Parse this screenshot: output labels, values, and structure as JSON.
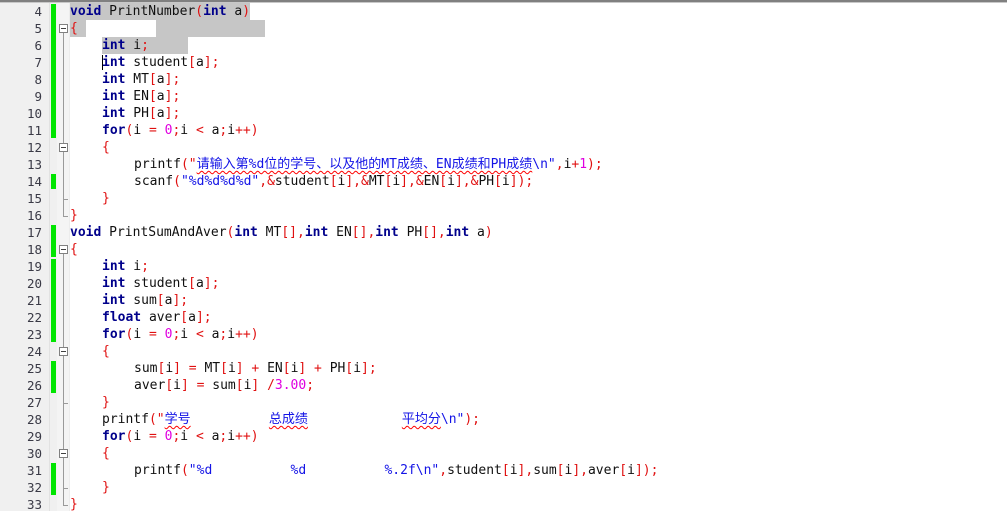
{
  "editor": {
    "first_line": 4,
    "last_line": 33,
    "line_height": 17,
    "colors": {
      "background": "#ffffff",
      "gutter_background": "#f0f0f0",
      "line_number": "#3a3a46",
      "keyword": "#00008b",
      "identifier": "#101010",
      "punctuation": "#e01010",
      "string": "#1414e6",
      "number": "#e000e0",
      "change_bar": "#00e500",
      "selection": "#c6c6c6",
      "fold_line": "#9a9a9a",
      "spellcheck_underline": "#ff0000"
    }
  },
  "lines": [
    {
      "n": "4",
      "indent": 0,
      "text": "void PrintNumber(int a)",
      "tokens": [
        [
          "kw",
          "void"
        ],
        [
          "id",
          " PrintNumber"
        ],
        [
          "pun",
          "("
        ],
        [
          "kw",
          "int"
        ],
        [
          "id",
          " a"
        ],
        [
          "pun",
          ")"
        ]
      ]
    },
    {
      "n": "5",
      "indent": 0,
      "text": "{",
      "tokens": [
        [
          "brc",
          "{"
        ]
      ]
    },
    {
      "n": "6",
      "indent": 1,
      "text": "int i;",
      "tokens": [
        [
          "kw",
          "int"
        ],
        [
          "id",
          " i"
        ],
        [
          "pun",
          ";"
        ]
      ]
    },
    {
      "n": "7",
      "indent": 1,
      "text": "int student[a];",
      "tokens": [
        [
          "kw",
          "int"
        ],
        [
          "id",
          " student"
        ],
        [
          "pun",
          "["
        ],
        [
          "id",
          "a"
        ],
        [
          "pun",
          "];"
        ]
      ]
    },
    {
      "n": "8",
      "indent": 1,
      "text": "int MT[a];",
      "tokens": [
        [
          "kw",
          "int"
        ],
        [
          "id",
          " MT"
        ],
        [
          "pun",
          "["
        ],
        [
          "id",
          "a"
        ],
        [
          "pun",
          "];"
        ]
      ]
    },
    {
      "n": "9",
      "indent": 1,
      "text": "int EN[a];",
      "tokens": [
        [
          "kw",
          "int"
        ],
        [
          "id",
          " EN"
        ],
        [
          "pun",
          "["
        ],
        [
          "id",
          "a"
        ],
        [
          "pun",
          "];"
        ]
      ]
    },
    {
      "n": "10",
      "indent": 1,
      "text": "int PH[a];",
      "tokens": [
        [
          "kw",
          "int"
        ],
        [
          "id",
          " PH"
        ],
        [
          "pun",
          "["
        ],
        [
          "id",
          "a"
        ],
        [
          "pun",
          "];"
        ]
      ]
    },
    {
      "n": "11",
      "indent": 1,
      "text": "for(i = 0;i < a;i++)",
      "tokens": [
        [
          "kw",
          "for"
        ],
        [
          "pun",
          "("
        ],
        [
          "id",
          "i "
        ],
        [
          "op",
          "="
        ],
        [
          "id",
          " "
        ],
        [
          "num",
          "0"
        ],
        [
          "pun",
          ";"
        ],
        [
          "id",
          "i "
        ],
        [
          "op",
          "<"
        ],
        [
          "id",
          " a"
        ],
        [
          "pun",
          ";"
        ],
        [
          "id",
          "i"
        ],
        [
          "op",
          "++"
        ],
        [
          "pun",
          ")"
        ]
      ]
    },
    {
      "n": "12",
      "indent": 1,
      "text": "{",
      "tokens": [
        [
          "brc",
          "{"
        ]
      ]
    },
    {
      "n": "13",
      "indent": 2,
      "text": "printf(\"请输入第%d位的学号、以及他的MT成绩、EN成绩和PH成绩\\n\",i+1);",
      "tokens": [
        [
          "id",
          "printf"
        ],
        [
          "pun",
          "(\""
        ],
        [
          "sq",
          "请输入第%d位的学号、以及他的MT成绩、EN成绩和PH成绩"
        ],
        [
          "str",
          "\\n\""
        ],
        [
          "pun",
          ","
        ],
        [
          "id",
          "i"
        ],
        [
          "op",
          "+"
        ],
        [
          "num",
          "1"
        ],
        [
          "pun",
          ");"
        ]
      ]
    },
    {
      "n": "14",
      "indent": 2,
      "text": "scanf(\"%d%d%d%d\",&student[i],&MT[i],&EN[i],&PH[i]);",
      "tokens": [
        [
          "id",
          "scanf"
        ],
        [
          "pun",
          "("
        ],
        [
          "str",
          "\"%d%d%d%d\""
        ],
        [
          "pun",
          ","
        ],
        [
          "op",
          "&"
        ],
        [
          "id",
          "student"
        ],
        [
          "pun",
          "["
        ],
        [
          "id",
          "i"
        ],
        [
          "pun",
          "],"
        ],
        [
          "op",
          "&"
        ],
        [
          "id",
          "MT"
        ],
        [
          "pun",
          "["
        ],
        [
          "id",
          "i"
        ],
        [
          "pun",
          "],"
        ],
        [
          "op",
          "&"
        ],
        [
          "id",
          "EN"
        ],
        [
          "pun",
          "["
        ],
        [
          "id",
          "i"
        ],
        [
          "pun",
          "],"
        ],
        [
          "op",
          "&"
        ],
        [
          "id",
          "PH"
        ],
        [
          "pun",
          "["
        ],
        [
          "id",
          "i"
        ],
        [
          "pun",
          "]);"
        ]
      ]
    },
    {
      "n": "15",
      "indent": 1,
      "text": "}",
      "tokens": [
        [
          "brc",
          "}"
        ]
      ]
    },
    {
      "n": "16",
      "indent": 0,
      "text": "}",
      "tokens": [
        [
          "brc",
          "}"
        ]
      ]
    },
    {
      "n": "17",
      "indent": 0,
      "text": "void PrintSumAndAver(int MT[],int EN[],int PH[],int a)",
      "tokens": [
        [
          "kw",
          "void"
        ],
        [
          "id",
          " PrintSumAndAver"
        ],
        [
          "pun",
          "("
        ],
        [
          "kw",
          "int"
        ],
        [
          "id",
          " MT"
        ],
        [
          "pun",
          "[],"
        ],
        [
          "kw",
          "int"
        ],
        [
          "id",
          " EN"
        ],
        [
          "pun",
          "[],"
        ],
        [
          "kw",
          "int"
        ],
        [
          "id",
          " PH"
        ],
        [
          "pun",
          "[],"
        ],
        [
          "kw",
          "int"
        ],
        [
          "id",
          " a"
        ],
        [
          "pun",
          ")"
        ]
      ]
    },
    {
      "n": "18",
      "indent": 0,
      "text": "{",
      "tokens": [
        [
          "brc",
          "{"
        ]
      ]
    },
    {
      "n": "19",
      "indent": 1,
      "text": "int i;",
      "tokens": [
        [
          "kw",
          "int"
        ],
        [
          "id",
          " i"
        ],
        [
          "pun",
          ";"
        ]
      ]
    },
    {
      "n": "20",
      "indent": 1,
      "text": "int student[a];",
      "tokens": [
        [
          "kw",
          "int"
        ],
        [
          "id",
          " student"
        ],
        [
          "pun",
          "["
        ],
        [
          "id",
          "a"
        ],
        [
          "pun",
          "];"
        ]
      ]
    },
    {
      "n": "21",
      "indent": 1,
      "text": "int sum[a];",
      "tokens": [
        [
          "kw",
          "int"
        ],
        [
          "id",
          " sum"
        ],
        [
          "pun",
          "["
        ],
        [
          "id",
          "a"
        ],
        [
          "pun",
          "];"
        ]
      ]
    },
    {
      "n": "22",
      "indent": 1,
      "text": "float aver[a];",
      "tokens": [
        [
          "kw",
          "float"
        ],
        [
          "id",
          " aver"
        ],
        [
          "pun",
          "["
        ],
        [
          "id",
          "a"
        ],
        [
          "pun",
          "];"
        ]
      ]
    },
    {
      "n": "23",
      "indent": 1,
      "text": "for(i = 0;i < a;i++)",
      "tokens": [
        [
          "kw",
          "for"
        ],
        [
          "pun",
          "("
        ],
        [
          "id",
          "i "
        ],
        [
          "op",
          "="
        ],
        [
          "id",
          " "
        ],
        [
          "num",
          "0"
        ],
        [
          "pun",
          ";"
        ],
        [
          "id",
          "i "
        ],
        [
          "op",
          "<"
        ],
        [
          "id",
          " a"
        ],
        [
          "pun",
          ";"
        ],
        [
          "id",
          "i"
        ],
        [
          "op",
          "++"
        ],
        [
          "pun",
          ")"
        ]
      ]
    },
    {
      "n": "24",
      "indent": 1,
      "text": "{",
      "tokens": [
        [
          "brc",
          "{"
        ]
      ]
    },
    {
      "n": "25",
      "indent": 2,
      "text": "sum[i] = MT[i] + EN[i] + PH[i];",
      "tokens": [
        [
          "id",
          "sum"
        ],
        [
          "pun",
          "["
        ],
        [
          "id",
          "i"
        ],
        [
          "pun",
          "]"
        ],
        [
          "id",
          " "
        ],
        [
          "op",
          "="
        ],
        [
          "id",
          " MT"
        ],
        [
          "pun",
          "["
        ],
        [
          "id",
          "i"
        ],
        [
          "pun",
          "]"
        ],
        [
          "id",
          " "
        ],
        [
          "op",
          "+"
        ],
        [
          "id",
          " EN"
        ],
        [
          "pun",
          "["
        ],
        [
          "id",
          "i"
        ],
        [
          "pun",
          "]"
        ],
        [
          "id",
          " "
        ],
        [
          "op",
          "+"
        ],
        [
          "id",
          " PH"
        ],
        [
          "pun",
          "["
        ],
        [
          "id",
          "i"
        ],
        [
          "pun",
          "];"
        ]
      ]
    },
    {
      "n": "26",
      "indent": 2,
      "text": "aver[i] = sum[i] /3.00;",
      "tokens": [
        [
          "id",
          "aver"
        ],
        [
          "pun",
          "["
        ],
        [
          "id",
          "i"
        ],
        [
          "pun",
          "]"
        ],
        [
          "id",
          " "
        ],
        [
          "op",
          "="
        ],
        [
          "id",
          " sum"
        ],
        [
          "pun",
          "["
        ],
        [
          "id",
          "i"
        ],
        [
          "pun",
          "]"
        ],
        [
          "id",
          " "
        ],
        [
          "op",
          "/"
        ],
        [
          "num",
          "3.00"
        ],
        [
          "pun",
          ";"
        ]
      ]
    },
    {
      "n": "27",
      "indent": 1,
      "text": "}",
      "tokens": [
        [
          "brc",
          "}"
        ]
      ]
    },
    {
      "n": "28",
      "indent": 1,
      "text": "printf(\"学号          总成绩            平均分\\n\");",
      "tokens": [
        [
          "id",
          "printf"
        ],
        [
          "pun",
          "(\""
        ],
        [
          "sq",
          "学号"
        ],
        [
          "str",
          "          "
        ],
        [
          "sq",
          "总成绩"
        ],
        [
          "str",
          "            "
        ],
        [
          "sq",
          "平均分"
        ],
        [
          "str",
          "\\n\""
        ],
        [
          "pun",
          ");"
        ]
      ]
    },
    {
      "n": "29",
      "indent": 1,
      "text": "for(i = 0;i < a;i++)",
      "tokens": [
        [
          "kw",
          "for"
        ],
        [
          "pun",
          "("
        ],
        [
          "id",
          "i "
        ],
        [
          "op",
          "="
        ],
        [
          "id",
          " "
        ],
        [
          "num",
          "0"
        ],
        [
          "pun",
          ";"
        ],
        [
          "id",
          "i "
        ],
        [
          "op",
          "<"
        ],
        [
          "id",
          " a"
        ],
        [
          "pun",
          ";"
        ],
        [
          "id",
          "i"
        ],
        [
          "op",
          "++"
        ],
        [
          "pun",
          ")"
        ]
      ]
    },
    {
      "n": "30",
      "indent": 1,
      "text": "{",
      "tokens": [
        [
          "brc",
          "{"
        ]
      ]
    },
    {
      "n": "31",
      "indent": 2,
      "text": "printf(\"%d          %d          %.2f\\n\",student[i],sum[i],aver[i]);",
      "tokens": [
        [
          "id",
          "printf"
        ],
        [
          "pun",
          "("
        ],
        [
          "str",
          "\"%d          %d          %.2f\\n\""
        ],
        [
          "pun",
          ","
        ],
        [
          "id",
          "student"
        ],
        [
          "pun",
          "["
        ],
        [
          "id",
          "i"
        ],
        [
          "pun",
          "],"
        ],
        [
          "id",
          "sum"
        ],
        [
          "pun",
          "["
        ],
        [
          "id",
          "i"
        ],
        [
          "pun",
          "],"
        ],
        [
          "id",
          "aver"
        ],
        [
          "pun",
          "["
        ],
        [
          "id",
          "i"
        ],
        [
          "pun",
          "]);"
        ]
      ]
    },
    {
      "n": "32",
      "indent": 1,
      "text": "}",
      "tokens": [
        [
          "brc",
          "}"
        ]
      ]
    },
    {
      "n": "33",
      "indent": 0,
      "text": "}",
      "tokens": [
        [
          "brc",
          "}"
        ]
      ]
    }
  ],
  "change_bars": [
    {
      "from_line": "4",
      "to_line": "11"
    },
    {
      "from_line": "14",
      "to_line": "14"
    },
    {
      "from_line": "17",
      "to_line": "18"
    },
    {
      "from_line": "19",
      "to_line": "23"
    },
    {
      "from_line": "25",
      "to_line": "26"
    },
    {
      "from_line": "31",
      "to_line": "32"
    }
  ],
  "fold_markers": [
    {
      "line": "5",
      "state": "expanded",
      "end_line": "16"
    },
    {
      "line": "12",
      "state": "expanded",
      "end_line": "15"
    },
    {
      "line": "18",
      "state": "expanded",
      "end_line": "33"
    },
    {
      "line": "24",
      "state": "expanded",
      "end_line": "27"
    },
    {
      "line": "30",
      "state": "expanded",
      "end_line": "32"
    }
  ],
  "selection": [
    {
      "line": "4",
      "from_col": 0,
      "to_col": 23
    },
    {
      "line": "5",
      "from_col": 0,
      "to_col": 2
    },
    {
      "line": "5",
      "from_col": 11,
      "to_col": 25
    },
    {
      "line": "6",
      "from_col": 0,
      "to_col": 11
    }
  ],
  "caret": {
    "line": "7",
    "col": 0
  }
}
